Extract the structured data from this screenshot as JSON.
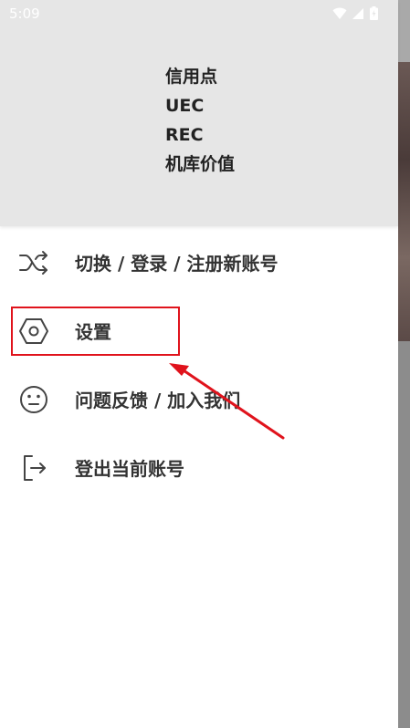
{
  "status_bar": {
    "time": "5:09",
    "icons": [
      "wifi-icon",
      "cell-signal-icon",
      "battery-icon"
    ]
  },
  "header": {
    "stats": [
      "信用点",
      "UEC",
      "REC",
      "机库价值"
    ]
  },
  "menu": {
    "items": [
      {
        "label": "切换 / 登录 / 注册新账号",
        "icon": "shuffle-icon"
      },
      {
        "label": "设置",
        "icon": "settings-hexagon-icon"
      },
      {
        "label": "问题反馈 / 加入我们",
        "icon": "neutral-face-icon"
      },
      {
        "label": "登出当前账号",
        "icon": "logout-icon"
      }
    ]
  },
  "colors": {
    "header_bg": "#e6e6e6",
    "annotation": "#e0131c",
    "icon": "#444444"
  }
}
